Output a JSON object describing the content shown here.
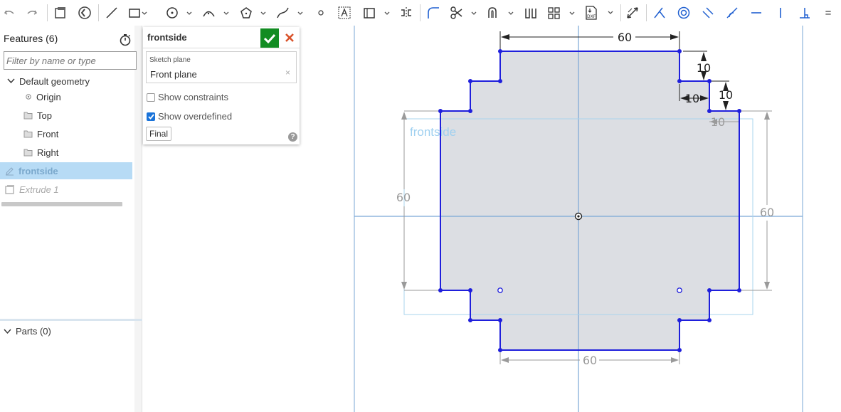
{
  "toolbar": {
    "tools": [
      {
        "name": "undo-icon"
      },
      {
        "name": "redo-icon"
      },
      {
        "name": "sketch-icon"
      },
      {
        "name": "sketch-tool-icon"
      },
      {
        "name": "line-icon"
      },
      {
        "name": "rectangle-icon"
      },
      {
        "name": "circle-icon"
      },
      {
        "name": "arc-icon"
      },
      {
        "name": "polygon-icon"
      },
      {
        "name": "spline-icon"
      },
      {
        "name": "point-icon"
      },
      {
        "name": "text-icon"
      },
      {
        "name": "construction-icon"
      },
      {
        "name": "mirror-icon"
      },
      {
        "name": "fillet-icon"
      },
      {
        "name": "trim-icon"
      },
      {
        "name": "offset-icon"
      },
      {
        "name": "pattern-icon"
      },
      {
        "name": "dxf-import-icon"
      },
      {
        "name": "dimension-icon"
      },
      {
        "name": "coincident-icon"
      },
      {
        "name": "concentric-icon"
      },
      {
        "name": "parallel-icon"
      },
      {
        "name": "tangent-icon"
      },
      {
        "name": "horizontal-icon"
      },
      {
        "name": "vertical-icon"
      },
      {
        "name": "perpendicular-icon"
      },
      {
        "name": "equal-icon"
      }
    ],
    "dxf_label": "DXF",
    "equal_label": "="
  },
  "features": {
    "title": "Features (6)",
    "filter_placeholder": "Filter by name or type",
    "default_geometry": "Default geometry",
    "origin": "Origin",
    "top": "Top",
    "front": "Front",
    "right": "Right",
    "sketch": "frontside",
    "extrude": "Extrude 1",
    "parts": "Parts (0)"
  },
  "sketch_dialog": {
    "name": "frontside",
    "plane_label": "Sketch plane",
    "plane_value": "Front plane",
    "show_constraints": "Show constraints",
    "show_constraints_checked": false,
    "show_overdefined": "Show overdefined",
    "show_overdefined_checked": true,
    "final_button": "Final",
    "help": "?"
  },
  "viewport": {
    "sketch_label": "frontside",
    "dimensions": {
      "top_width": "60",
      "right_step_v": "10",
      "right_step_h": "10",
      "right_step_v2": "10",
      "right_step_h2": "10",
      "left_height": "60",
      "right_height": "60",
      "bottom_width": "60"
    },
    "colors": {
      "sketch_line": "#1f1fdc",
      "fill": "#dcdee3",
      "axis": "#7aa7d6",
      "plane": "#aad4ee",
      "dim_active": "#222222",
      "dim_inactive": "#9a9a9a"
    }
  }
}
